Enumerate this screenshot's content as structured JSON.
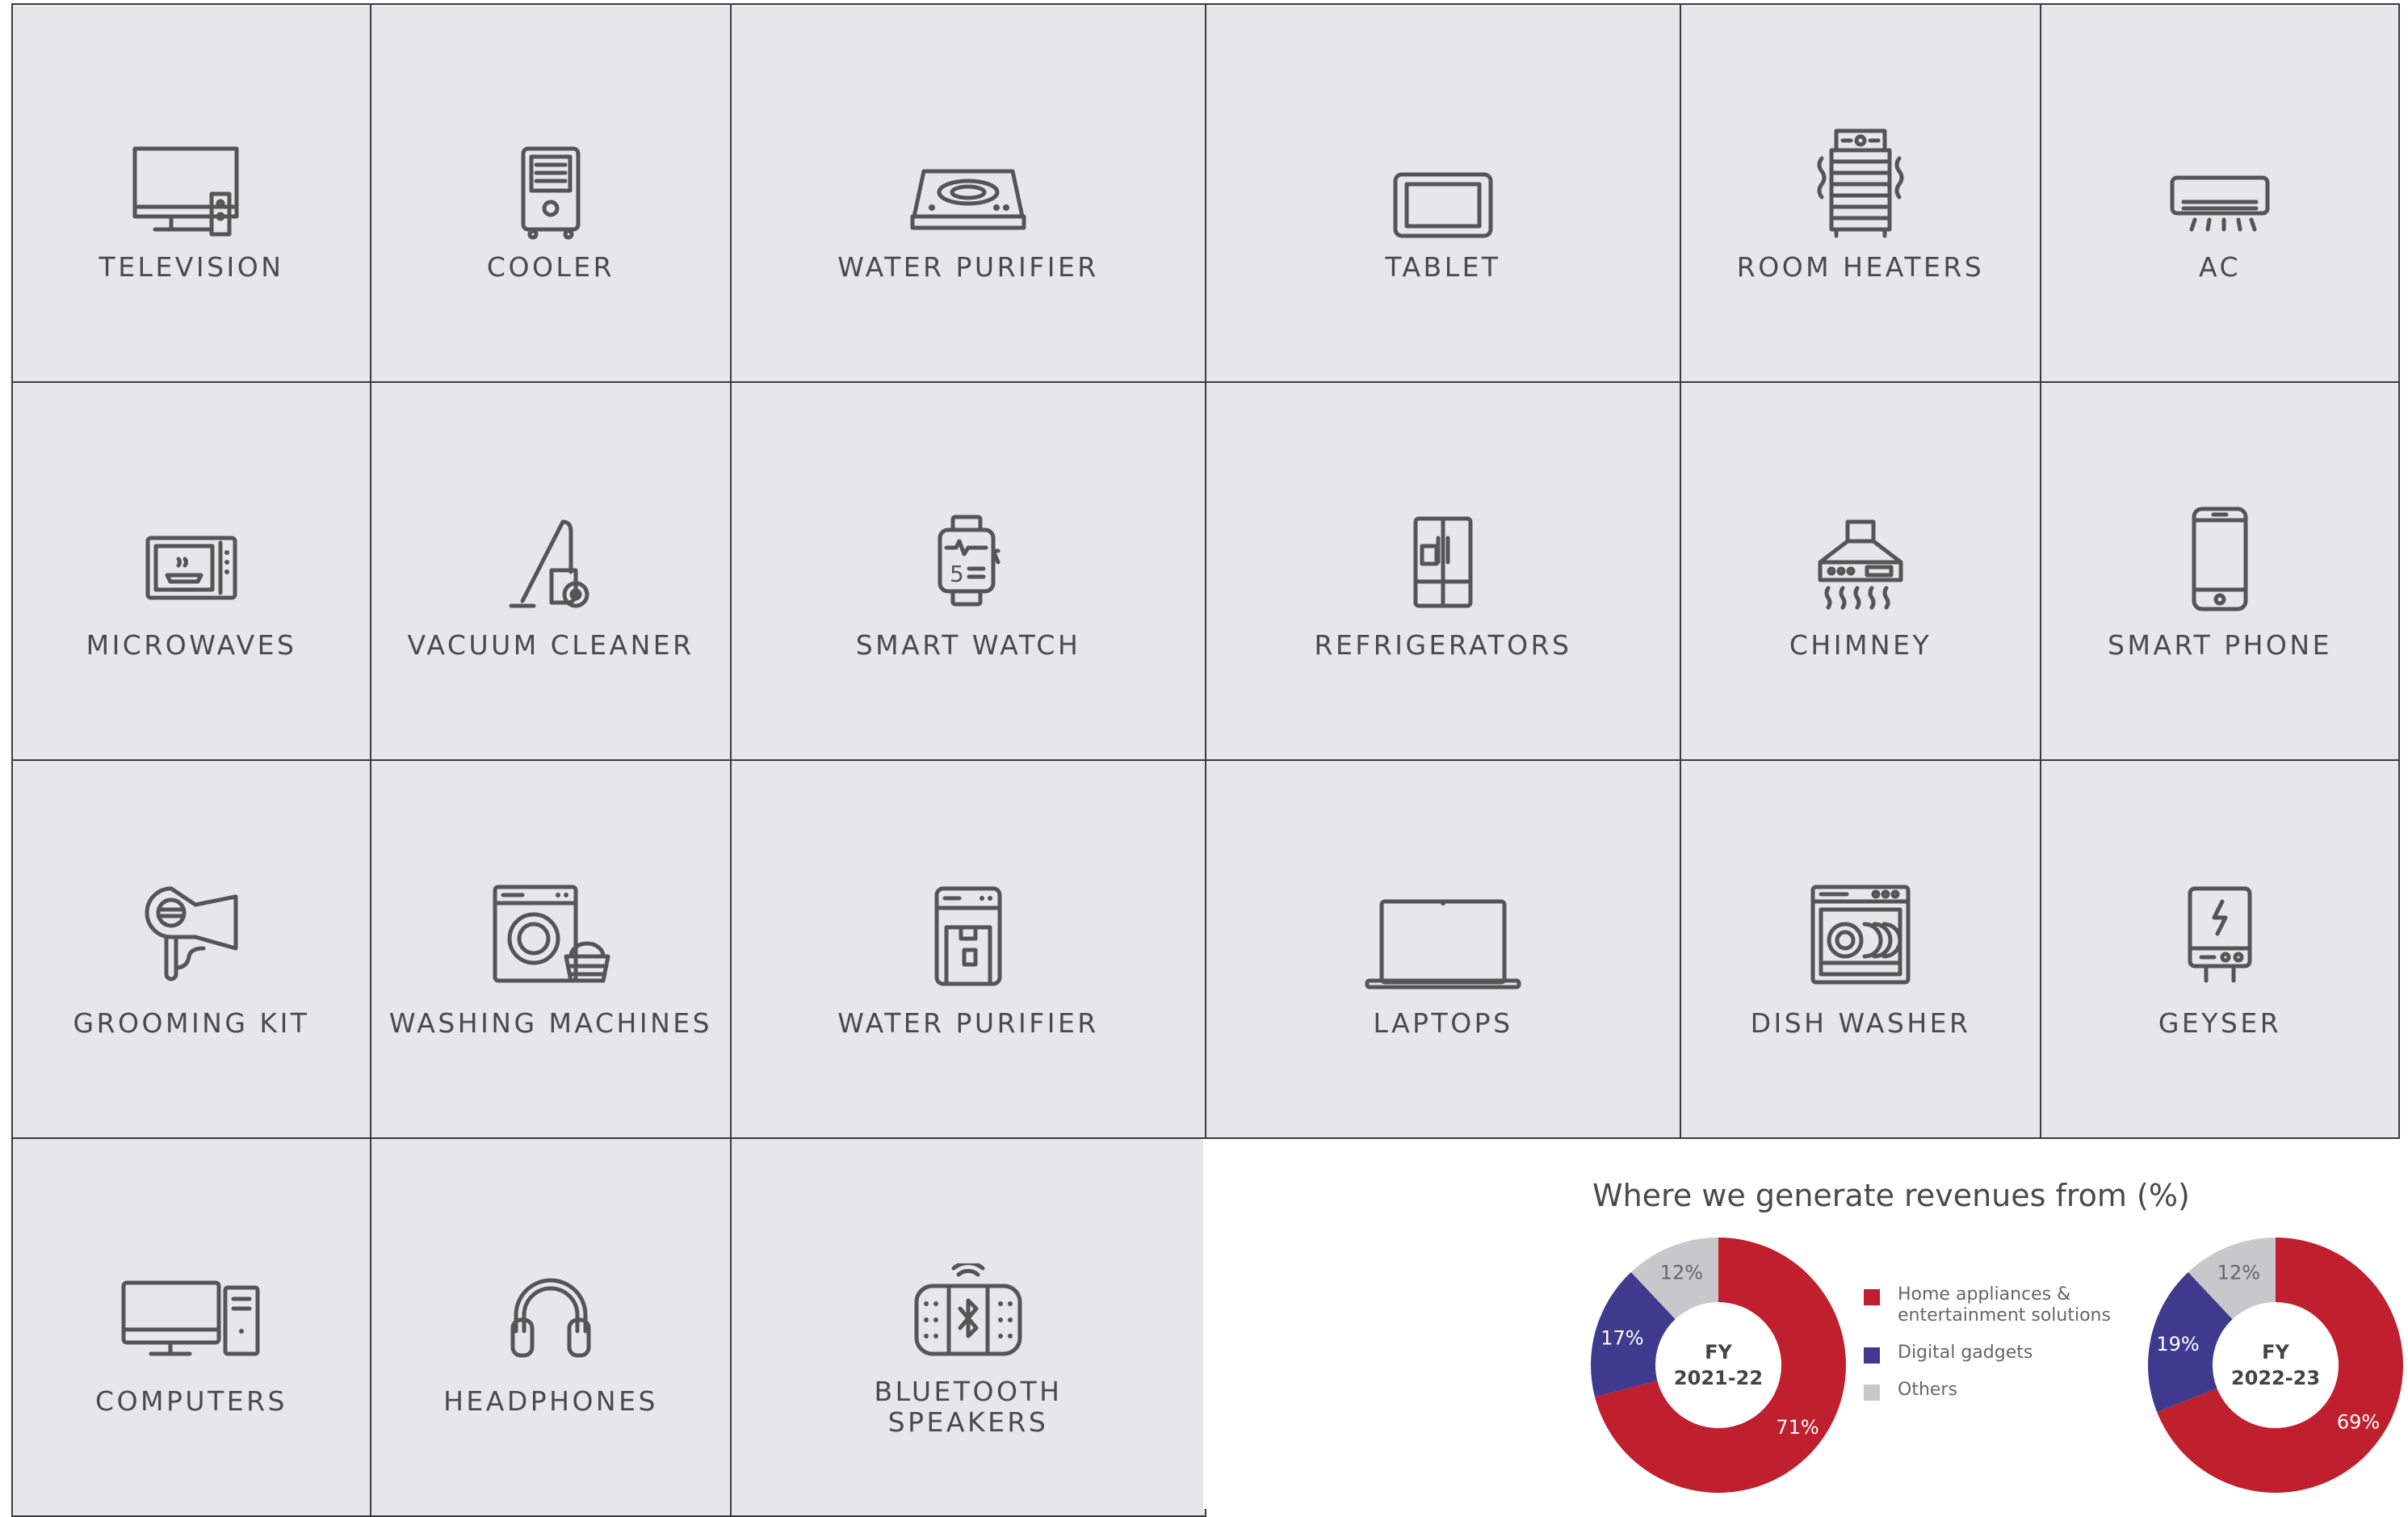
{
  "products": {
    "television": "TELEVISION",
    "cooler": "COOLER",
    "water_purifier_1": "WATER PURIFIER",
    "tablet": "TABLET",
    "room_heaters": "ROOM HEATERS",
    "ac": "AC",
    "microwaves": "MICROWAVES",
    "vacuum_cleaner": "VACUUM CLEANER",
    "smart_watch": "SMART WATCH",
    "refrigerators": "REFRIGERATORS",
    "chimney": "CHIMNEY",
    "smart_phone": "SMART PHONE",
    "grooming_kit": "GROOMING KIT",
    "washing_machines": "WASHING MACHINES",
    "water_purifier_2": "WATER PURIFIER",
    "laptops": "LAPTOPS",
    "dish_washer": "DISH WASHER",
    "geyser": "GEYSER",
    "computers": "COMPUTERS",
    "headphones": "HEADPHONES",
    "bluetooth_line1": "BLUETOOTH",
    "bluetooth_line2": "SPEAKERS"
  },
  "colors": {
    "home": "#c0202e",
    "digital": "#3f3a8e",
    "others": "#c8c8ca",
    "cell_bg": "#e6e7e9"
  },
  "chart_data": {
    "type": "pie",
    "title": "Where we generate revenues from (%)",
    "categories": [
      "Home appliances & entertainment solutions",
      "Digital gadgets",
      "Others"
    ],
    "legend": [
      "Home appliances &",
      "entertainment solutions",
      "Digital gadgets",
      "Others"
    ],
    "charts": [
      {
        "label_line1": "FY",
        "label_line2": "2021-22",
        "values": [
          71,
          17,
          12
        ],
        "labels": [
          "71%",
          "17%",
          "12%"
        ]
      },
      {
        "label_line1": "FY",
        "label_line2": "2022-23",
        "values": [
          69,
          19,
          12
        ],
        "labels": [
          "69%",
          "19%",
          "12%"
        ]
      }
    ]
  }
}
